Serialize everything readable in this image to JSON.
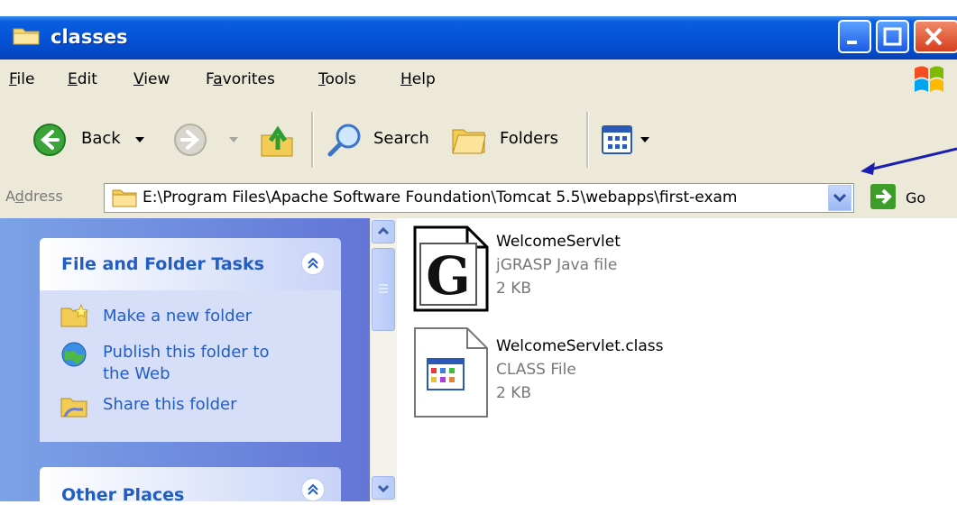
{
  "window": {
    "title": "classes"
  },
  "menu": [
    {
      "label": "File",
      "u": "F",
      "rest": "ile"
    },
    {
      "label": "Edit",
      "u": "E",
      "rest": "dit"
    },
    {
      "label": "View",
      "u": "V",
      "rest": "iew"
    },
    {
      "label": "Favorites",
      "pre": "F",
      "u": "a",
      "rest": "vorites"
    },
    {
      "label": "Tools",
      "u": "T",
      "rest": "ools"
    },
    {
      "label": "Help",
      "u": "H",
      "rest": "elp"
    }
  ],
  "toolbar": {
    "back_label": "Back",
    "search_label": "Search",
    "folders_label": "Folders"
  },
  "address": {
    "label_pre": "A",
    "label_u": "d",
    "label_rest": "dress",
    "value": "E:\\Program Files\\Apache Software Foundation\\Tomcat 5.5\\webapps\\first-exam",
    "go_label": "Go"
  },
  "taskpane": {
    "file_folder_tasks": {
      "title": "File and Folder Tasks",
      "items": [
        "Make a new folder",
        "Publish this folder to",
        "the Web",
        "Share this folder"
      ]
    },
    "other_places": {
      "title": "Other Places"
    }
  },
  "files": [
    {
      "name": "WelcomeServlet",
      "type": "jGRASP Java file",
      "size": "2 KB"
    },
    {
      "name": "WelcomeServlet.class",
      "type": "CLASS File",
      "size": "2 KB"
    }
  ],
  "colors": {
    "titlebar": "#0553d7",
    "taskpane_link": "#215dc6",
    "arrow": "#1a1fb0"
  }
}
